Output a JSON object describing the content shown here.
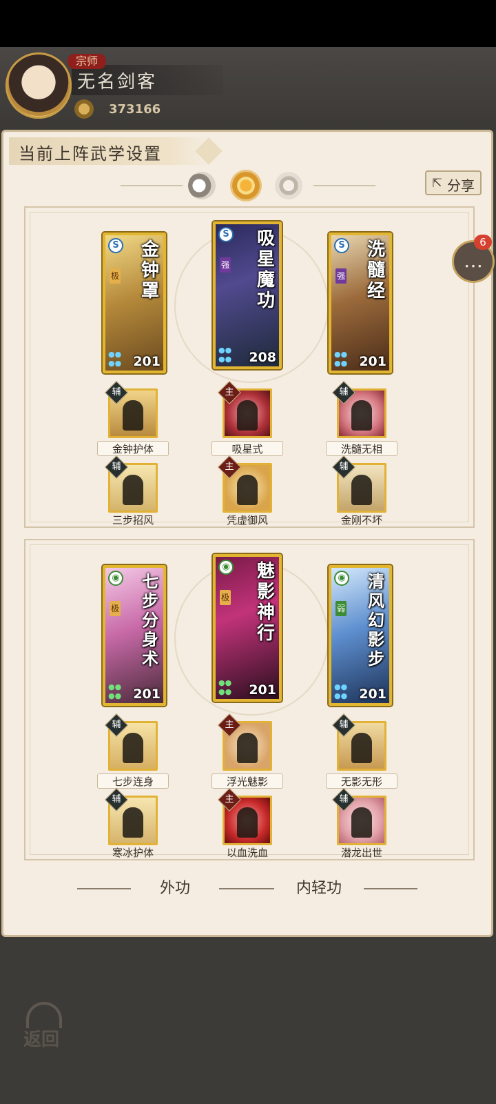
{
  "player": {
    "rank": "宗师",
    "name": "无名剑客",
    "power": "373166"
  },
  "panel": {
    "title": "当前上阵武学设置",
    "share_label": "分享",
    "chat_badge": "6",
    "modes": [
      "moon-icon",
      "sun-icon",
      "ring-icon"
    ]
  },
  "groups": [
    {
      "cards": [
        {
          "name": "金钟罩",
          "tier": "极",
          "level": "201",
          "element": "blue"
        },
        {
          "name": "吸星魔功",
          "tier": "强",
          "level": "208",
          "element": "blue"
        },
        {
          "name": "洗髓经",
          "tier": "强",
          "level": "201",
          "element": "blue"
        }
      ],
      "skills_row1": [
        {
          "tag": "辅",
          "label": "金钟护体"
        },
        {
          "tag": "主",
          "label": "吸星式"
        },
        {
          "tag": "辅",
          "label": "洗髓无相"
        }
      ],
      "skills_row2": [
        {
          "tag": "辅",
          "label": "三步招风"
        },
        {
          "tag": "主",
          "label": "凭虚御风"
        },
        {
          "tag": "辅",
          "label": "金刚不坏"
        }
      ]
    },
    {
      "cards": [
        {
          "name": "七步分身术",
          "tier": "极",
          "level": "201",
          "element": "green"
        },
        {
          "name": "魅影神行",
          "tier": "极",
          "level": "201",
          "element": "green"
        },
        {
          "name": "清风幻影步",
          "tier": "弱",
          "level": "201",
          "element": "green"
        }
      ],
      "skills_row1": [
        {
          "tag": "辅",
          "label": "七步连身"
        },
        {
          "tag": "主",
          "label": "浮光魅影"
        },
        {
          "tag": "辅",
          "label": "无影无形"
        }
      ],
      "skills_row2": [
        {
          "tag": "辅",
          "label": "寒冰护体"
        },
        {
          "tag": "主",
          "label": "以血洗血"
        },
        {
          "tag": "辅",
          "label": "潜龙出世"
        }
      ]
    }
  ],
  "tabs": {
    "outer": "外功",
    "inner": "内轻功"
  },
  "back_label": "返回"
}
